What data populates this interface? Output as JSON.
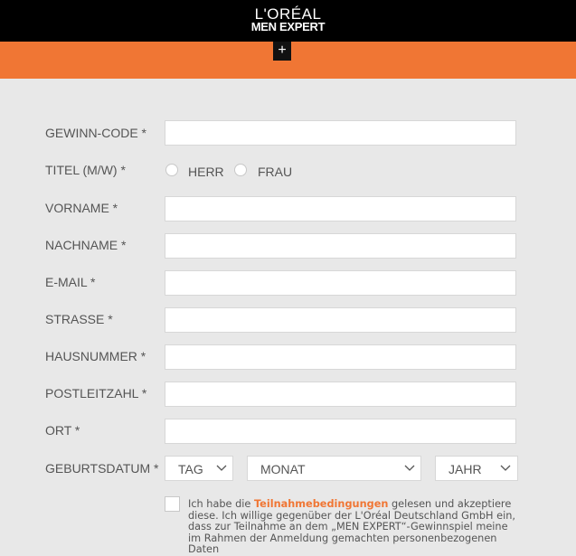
{
  "brand": {
    "logo_top": "L'ORÉAL",
    "logo_bottom": "MEN EXPERT",
    "accent_color": "#f07634"
  },
  "header": {
    "plus_icon": "plus"
  },
  "form": {
    "gewinn_code_label": "GEWINN-CODE *",
    "titel_label": "TITEL (M/W) *",
    "titel_options": [
      "HERR",
      "FRAU"
    ],
    "vorname_label": "VORNAME *",
    "nachname_label": "NACHNAME *",
    "email_label": "E-MAIL *",
    "strasse_label": "STRASSE *",
    "hausnummer_label": "HAUSNUMMER *",
    "postleitzahl_label": "POSTLEITZAHL *",
    "ort_label": "ORT *",
    "geburtsdatum_label": "GEBURTSDATUM *",
    "tag_select": "TAG",
    "monat_select": "MONAT",
    "jahr_select": "JAHR"
  },
  "consent": {
    "text_before": "Ich habe die ",
    "link_text": "Teilnahmebedingungen",
    "text_after": " gelesen und akzeptiere diese. Ich willige gegenüber der L'Oréal Deutschland GmbH ein, dass zur Teilnahme an dem „MEN EXPERT“-Gewinnspiel meine im Rahmen der Anmeldung gemachten personenbezogenen Daten"
  }
}
